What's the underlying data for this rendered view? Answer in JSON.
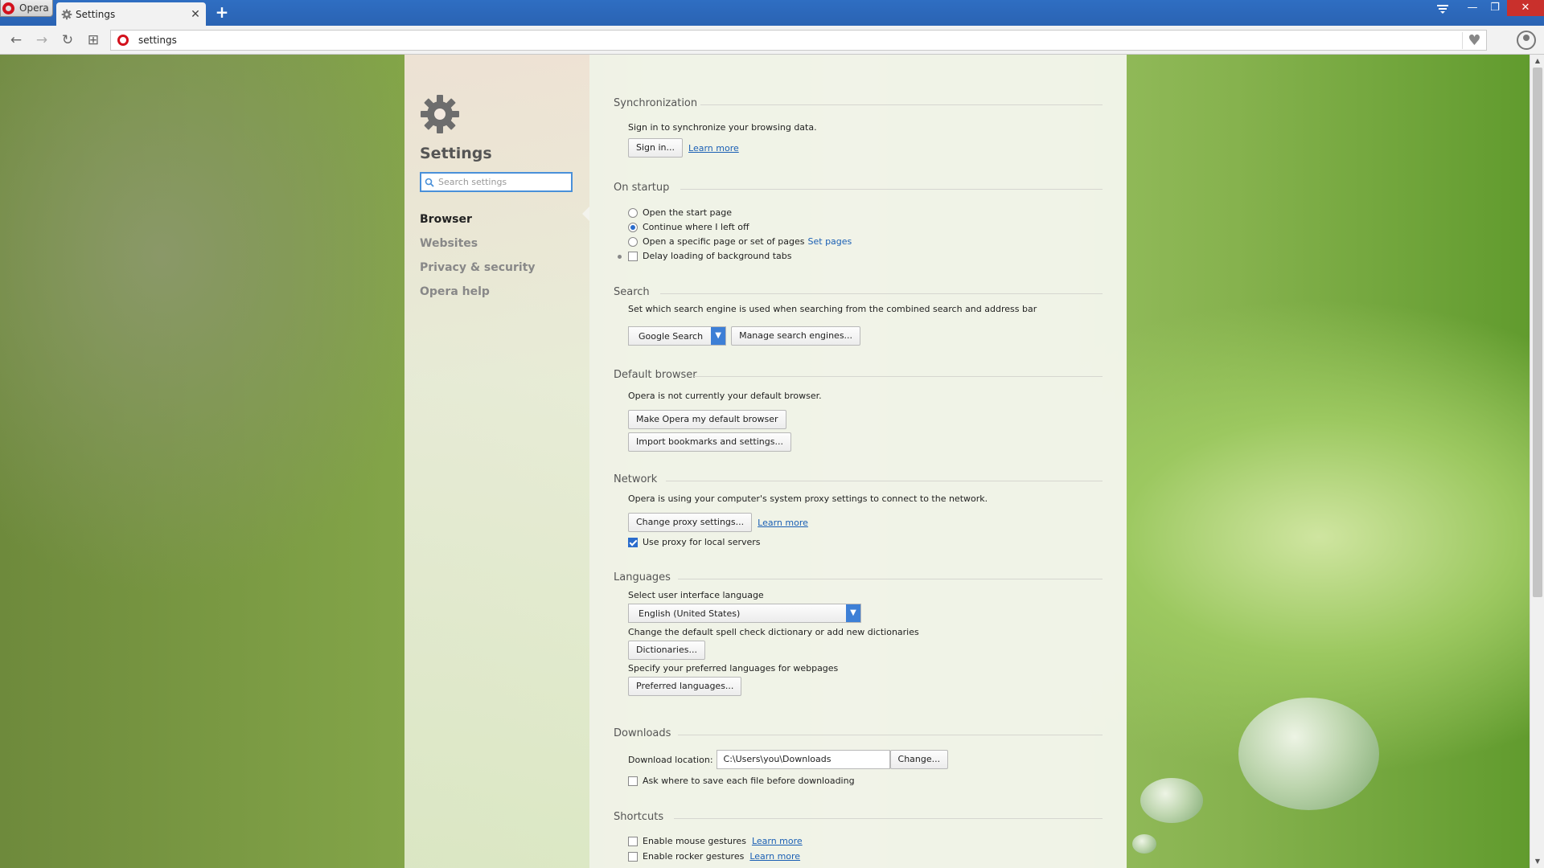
{
  "titlebar": {
    "menu_label": "Opera",
    "tab_title": "Settings",
    "tab_close": "✕",
    "new_tab": "+",
    "window_controls": {
      "minimize": "—",
      "maximize": "❐",
      "close": "✕"
    }
  },
  "navbar": {
    "back": "←",
    "forward": "→",
    "reload": "↻",
    "speed_dial": "⊞",
    "address": "settings"
  },
  "sidebar": {
    "title": "Settings",
    "search_placeholder": "Search settings",
    "items": [
      {
        "label": "Browser",
        "active": true
      },
      {
        "label": "Websites",
        "active": false
      },
      {
        "label": "Privacy & security",
        "active": false
      },
      {
        "label": "Opera help",
        "active": false
      }
    ]
  },
  "sections": {
    "sync": {
      "title": "Synchronization",
      "desc": "Sign in to synchronize your browsing data.",
      "signin_btn": "Sign in...",
      "learn_more": "Learn more"
    },
    "startup": {
      "title": "On startup",
      "options": [
        "Open the start page",
        "Continue where I left off",
        "Open a specific page or set of pages"
      ],
      "selected": 1,
      "set_pages": "Set pages",
      "delay_label": "Delay loading of background tabs"
    },
    "search": {
      "title": "Search",
      "desc": "Set which search engine is used when searching from the combined search and address bar",
      "engine": "Google Search",
      "manage_btn": "Manage search engines..."
    },
    "default_browser": {
      "title": "Default browser",
      "desc": "Opera is not currently your default browser.",
      "make_default_btn": "Make Opera my default browser",
      "import_btn": "Import bookmarks and settings..."
    },
    "network": {
      "title": "Network",
      "desc": "Opera is using your computer's system proxy settings to connect to the network.",
      "proxy_btn": "Change proxy settings...",
      "learn_more": "Learn more",
      "local_proxy_label": "Use proxy for local servers"
    },
    "languages": {
      "title": "Languages",
      "ui_lang_label": "Select user interface language",
      "ui_lang_value": "English (United States)",
      "spell_desc": "Change the default spell check dictionary or add new dictionaries",
      "dict_btn": "Dictionaries...",
      "pref_desc": "Specify your preferred languages for webpages",
      "pref_btn": "Preferred languages..."
    },
    "downloads": {
      "title": "Downloads",
      "location_label": "Download location:",
      "location_value": "C:\\Users\\you\\Downloads",
      "change_btn": "Change...",
      "ask_label": "Ask where to save each file before downloading"
    },
    "shortcuts": {
      "title": "Shortcuts",
      "mouse_label": "Enable mouse gestures",
      "rocker_label": "Enable rocker gestures",
      "learn_more": "Learn more"
    }
  },
  "colors": {
    "accent": "#2a6ccc",
    "titlebar": "#2f6ec2",
    "opera_red": "#d3111c"
  }
}
